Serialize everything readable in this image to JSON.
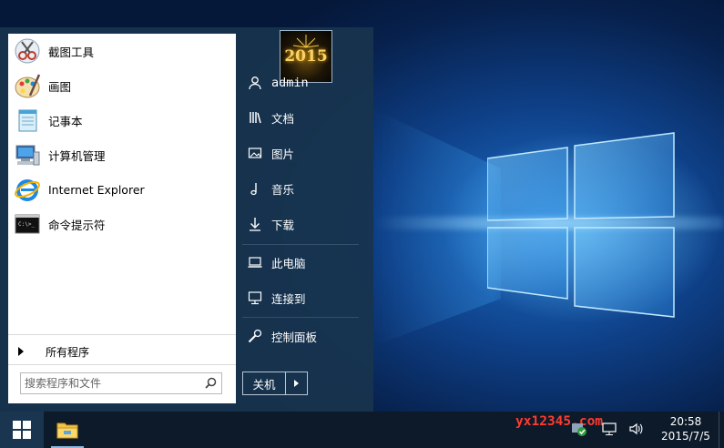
{
  "start_menu": {
    "programs": [
      {
        "label": "截图工具",
        "icon": "snipping-tool-icon"
      },
      {
        "label": "画图",
        "icon": "paint-palette-icon"
      },
      {
        "label": "记事本",
        "icon": "notepad-icon"
      },
      {
        "label": "计算机管理",
        "icon": "computer-management-icon"
      },
      {
        "label": "Internet Explorer",
        "icon": "internet-explorer-icon"
      },
      {
        "label": "命令提示符",
        "icon": "command-prompt-icon"
      }
    ],
    "all_programs_label": "所有程序",
    "search_placeholder": "搜索程序和文件",
    "user_avatar_text": "2015",
    "right_items": [
      {
        "label": "admin",
        "icon": "user-icon"
      },
      {
        "label": "文档",
        "icon": "documents-icon"
      },
      {
        "label": "图片",
        "icon": "pictures-icon"
      },
      {
        "label": "音乐",
        "icon": "music-icon"
      },
      {
        "label": "下载",
        "icon": "download-icon"
      },
      {
        "label": "此电脑",
        "icon": "this-pc-icon"
      },
      {
        "label": "连接到",
        "icon": "connect-to-icon"
      },
      {
        "label": "控制面板",
        "icon": "control-panel-icon"
      }
    ],
    "shutdown_label": "关机"
  },
  "taskbar": {
    "watermark": "yx12345.com",
    "time": "20:58",
    "date": "2015/7/5"
  },
  "colors": {
    "menu_background": "#18344e",
    "taskbar": "#0c1a2a",
    "watermark": "#ff3b30",
    "desktop_blue": "#1d6fc9"
  }
}
